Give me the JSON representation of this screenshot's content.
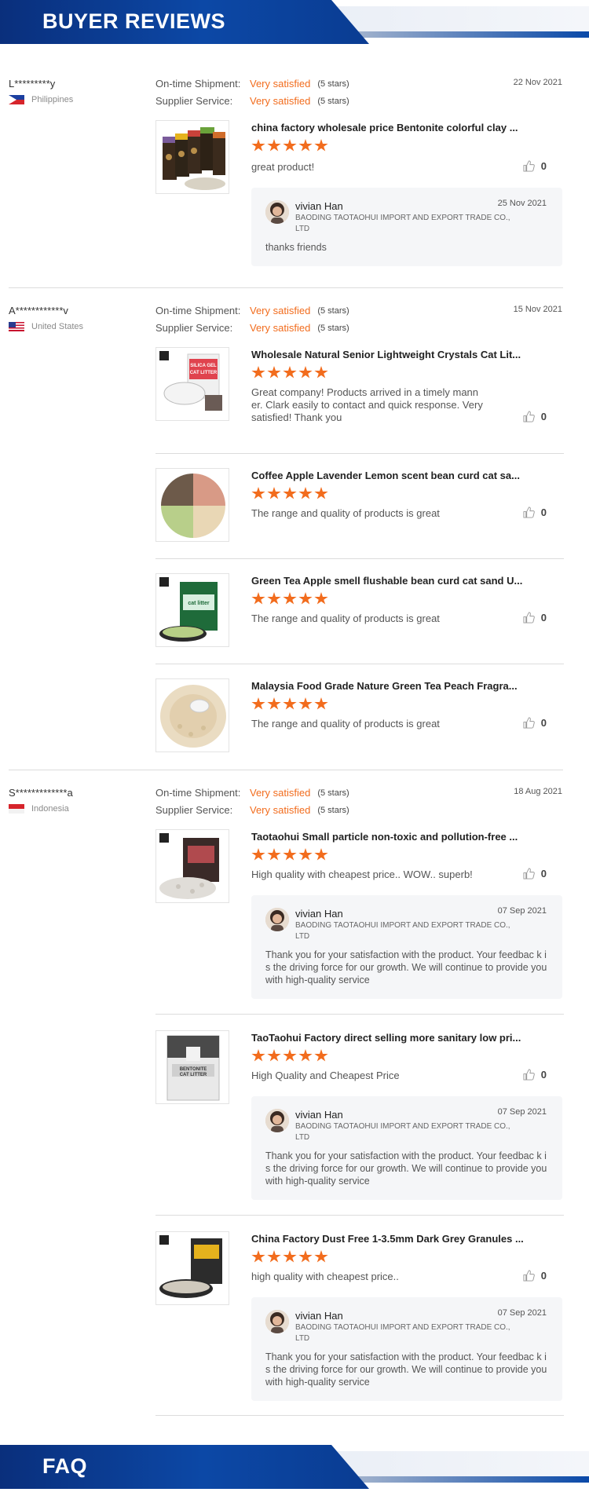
{
  "buyer_reviews_title": "BUYER REVIEWS",
  "faq_title": "FAQ",
  "labels": {
    "ontime": "On-time Shipment:",
    "supplier": "Supplier Service:",
    "satisfied": "Very satisfied",
    "five_stars": "(5 stars)"
  },
  "reviews": [
    {
      "buyer": "L*********y",
      "country": "Philippines",
      "date": "22 Nov 2021",
      "items": [
        {
          "title": "china factory wholesale price Bentonite colorful clay ...",
          "comment": "great product!",
          "likes": "0",
          "reply": {
            "name": "vivian Han",
            "company": "BAODING TAOTAOHUI IMPORT AND EXPORT TRADE CO., LTD",
            "date": "25 Nov 2021",
            "text": "thanks friends"
          }
        }
      ]
    },
    {
      "buyer": "A************v",
      "country": "United States",
      "date": "15 Nov 2021",
      "items": [
        {
          "title": "Wholesale Natural Senior Lightweight Crystals Cat Lit...",
          "comment": "Great company! Products arrived in a timely mann er. Clark easily to contact and quick response. Very satisfied! Thank you",
          "likes": "0"
        },
        {
          "title": "Coffee Apple Lavender Lemon scent bean curd cat sa...",
          "comment": "The range and quality of products is great",
          "likes": "0"
        },
        {
          "title": "Green Tea Apple smell flushable bean curd cat sand U...",
          "comment": "The range and quality of products is great",
          "likes": "0"
        },
        {
          "title": "Malaysia Food Grade Nature Green Tea Peach Fragra...",
          "comment": "The range and quality of products is great",
          "likes": "0"
        }
      ]
    },
    {
      "buyer": "S*************a",
      "country": "Indonesia",
      "date": "18 Aug 2021",
      "items": [
        {
          "title": "Taotaohui Small particle non-toxic and pollution-free ...",
          "comment": "High quality with cheapest price.. WOW.. superb!",
          "likes": "0",
          "reply": {
            "name": "vivian Han",
            "company": "BAODING TAOTAOHUI IMPORT AND EXPORT TRADE CO., LTD",
            "date": "07 Sep 2021",
            "text": "Thank you for your satisfaction with the product. Your feedbac k is the driving force for our growth. We will continue to provide you with high-quality service"
          }
        },
        {
          "title": "TaoTaohui Factory direct selling more sanitary low pri...",
          "comment": "High Quality and Cheapest Price",
          "likes": "0",
          "reply": {
            "name": "vivian Han",
            "company": "BAODING TAOTAOHUI IMPORT AND EXPORT TRADE CO., LTD",
            "date": "07 Sep 2021",
            "text": "Thank you for your satisfaction with the product. Your feedbac k is the driving force for our growth. We will continue to provide you with high-quality service"
          }
        },
        {
          "title": "China Factory Dust Free 1-3.5mm Dark Grey Granules ...",
          "comment": "high quality with cheapest price..",
          "likes": "0",
          "reply": {
            "name": "vivian Han",
            "company": "BAODING TAOTAOHUI IMPORT AND EXPORT TRADE CO., LTD",
            "date": "07 Sep 2021",
            "text": "Thank you for your satisfaction with the product. Your feedbac k is the driving force for our growth. We will continue to provide you with high-quality service"
          }
        }
      ]
    }
  ],
  "colors": {
    "accent": "#f26c1d",
    "banner": "#0c48a6"
  }
}
